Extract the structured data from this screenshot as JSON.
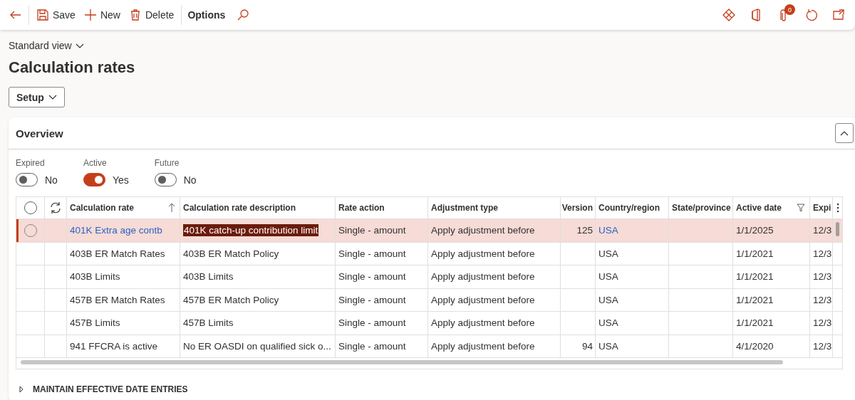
{
  "toolbar": {
    "left": [
      {
        "kind": "back"
      },
      {
        "kind": "save",
        "label": "Save"
      },
      {
        "kind": "new",
        "label": "New"
      },
      {
        "kind": "delete",
        "label": "Delete"
      },
      {
        "kind": "options",
        "label": "Options"
      },
      {
        "kind": "search"
      }
    ],
    "right": [
      {
        "kind": "diamonds"
      },
      {
        "kind": "office"
      },
      {
        "kind": "attach",
        "badge": "0"
      },
      {
        "kind": "refresh"
      },
      {
        "kind": "popout"
      }
    ]
  },
  "view_selector": "Standard view",
  "title": "Calculation rates",
  "setup_button": "Setup",
  "overview": {
    "title": "Overview",
    "expanded": true,
    "filters": [
      {
        "label": "Expired",
        "on": false,
        "value": "No"
      },
      {
        "label": "Active",
        "on": true,
        "value": "Yes"
      },
      {
        "label": "Future",
        "on": false,
        "value": "No"
      }
    ],
    "table": {
      "all_selected": false,
      "columns": [
        {
          "label": "Calculation rate",
          "kind": "link",
          "sorted": true,
          "filtered": false
        },
        {
          "label": "Calculation rate description",
          "kind": "text",
          "sorted": false,
          "filtered": false
        },
        {
          "label": "Rate action",
          "kind": "text",
          "sorted": false,
          "filtered": false
        },
        {
          "label": "Adjustment type",
          "kind": "text",
          "sorted": false,
          "filtered": false
        },
        {
          "label": "Version",
          "kind": "number",
          "sorted": false,
          "filtered": false
        },
        {
          "label": "Country/region",
          "kind": "link",
          "sorted": false,
          "filtered": false
        },
        {
          "label": "State/province",
          "kind": "text",
          "sorted": false,
          "filtered": false
        },
        {
          "label": "Active date",
          "kind": "text",
          "sorted": false,
          "filtered": true
        },
        {
          "label": "Expi",
          "kind": "text",
          "sorted": false,
          "filtered": false
        }
      ],
      "rows": [
        {
          "selected": true,
          "text_selected": true,
          "cells": [
            "401K Extra age contb",
            "401K catch-up contribution limit",
            "Single - amount",
            "Apply adjustment before",
            "125",
            "USA",
            "",
            "1/1/2025",
            "12/3"
          ]
        },
        {
          "selected": false,
          "text_selected": false,
          "cells": [
            "403B ER Match Rates",
            "403B ER Match Policy",
            "Single - amount",
            "Apply adjustment before",
            "",
            "USA",
            "",
            "1/1/2021",
            "12/3"
          ]
        },
        {
          "selected": false,
          "text_selected": false,
          "cells": [
            "403B Limits",
            "403B Limits",
            "Single - amount",
            "Apply adjustment before",
            "",
            "USA",
            "",
            "1/1/2021",
            "12/3"
          ]
        },
        {
          "selected": false,
          "text_selected": false,
          "cells": [
            "457B ER Match Rates",
            "457B ER Match Policy",
            "Single - amount",
            "Apply adjustment before",
            "",
            "USA",
            "",
            "1/1/2021",
            "12/3"
          ]
        },
        {
          "selected": false,
          "text_selected": false,
          "cells": [
            "457B Limits",
            "457B Limits",
            "Single - amount",
            "Apply adjustment before",
            "",
            "USA",
            "",
            "1/1/2021",
            "12/3"
          ]
        },
        {
          "selected": false,
          "text_selected": false,
          "cells": [
            "941 FFCRA is active",
            "No ER OASDI on qualified sick o...",
            "Single - amount",
            "Apply adjustment before",
            "94",
            "USA",
            "",
            "4/1/2020",
            "12/3"
          ]
        }
      ]
    }
  },
  "maintain_section": {
    "title": "MAINTAIN EFFECTIVE DATE ENTRIES",
    "expanded": false
  }
}
